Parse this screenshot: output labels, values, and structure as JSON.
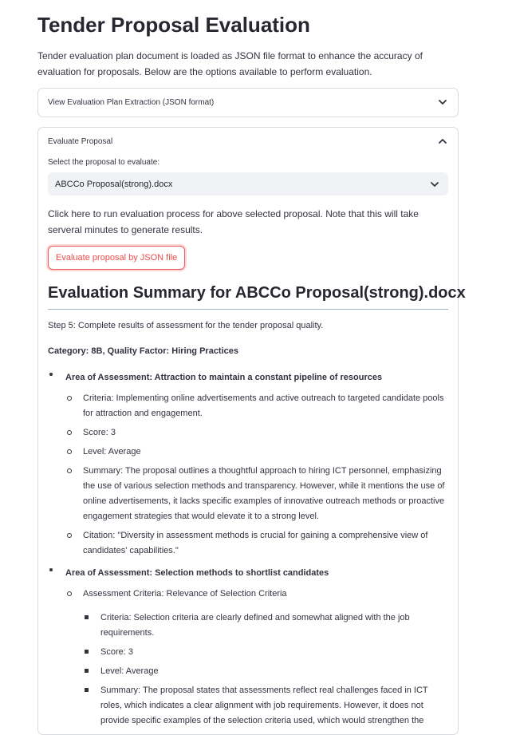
{
  "page": {
    "title": "Tender Proposal Evaluation",
    "intro": "Tender evaluation plan document is loaded as JSON file format to enhance the accuracy of evaluation for proposals. Below are the options available to perform evaluation."
  },
  "expander_plan": {
    "label": "View Evaluation Plan Extraction (JSON format)"
  },
  "expander_eval": {
    "label": "Evaluate Proposal",
    "select_label": "Select the proposal to evaluate:",
    "selected_proposal": "ABCCo Proposal(strong).docx",
    "note": "Click here to run evaluation process for above selected proposal. Note that this will take serveral minutes to generate results.",
    "button_label": "Evaluate proposal by JSON file"
  },
  "summary": {
    "heading": "Evaluation Summary for ABCCo Proposal(strong).docx",
    "step": "Step 5: Complete results of assessment for the tender proposal quality.",
    "category": "Category: 8B, Quality Factor: Hiring Practices",
    "areas": [
      {
        "title": "Area of Assessment: Attraction to maintain a constant pipeline of resources",
        "items": [
          "Criteria: Implementing online advertisements and active outreach to targeted candidate pools for attraction and engagement.",
          "Score: 3",
          "Level: Average",
          "Summary: The proposal outlines a thoughtful approach to hiring ICT personnel, emphasizing the use of various selection methods and transparency. However, while it mentions the use of online advertisements, it lacks specific examples of innovative outreach methods or proactive engagement strategies that would elevate it to a strong level.",
          "Citation: \"Diversity in assessment methods is crucial for gaining a comprehensive view of candidates' capabilities.\""
        ]
      },
      {
        "title": "Area of Assessment: Selection methods to shortlist candidates",
        "sub_title": "Assessment Criteria: Relevance of Selection Criteria",
        "items": [
          "Criteria: Selection criteria are clearly defined and somewhat aligned with the job requirements.",
          "Score: 3",
          "Level: Average",
          "Summary: The proposal states that assessments reflect real challenges faced in ICT roles, which indicates a clear alignment with job requirements. However, it does not provide specific examples of the selection criteria used, which would strengthen the"
        ]
      }
    ]
  }
}
